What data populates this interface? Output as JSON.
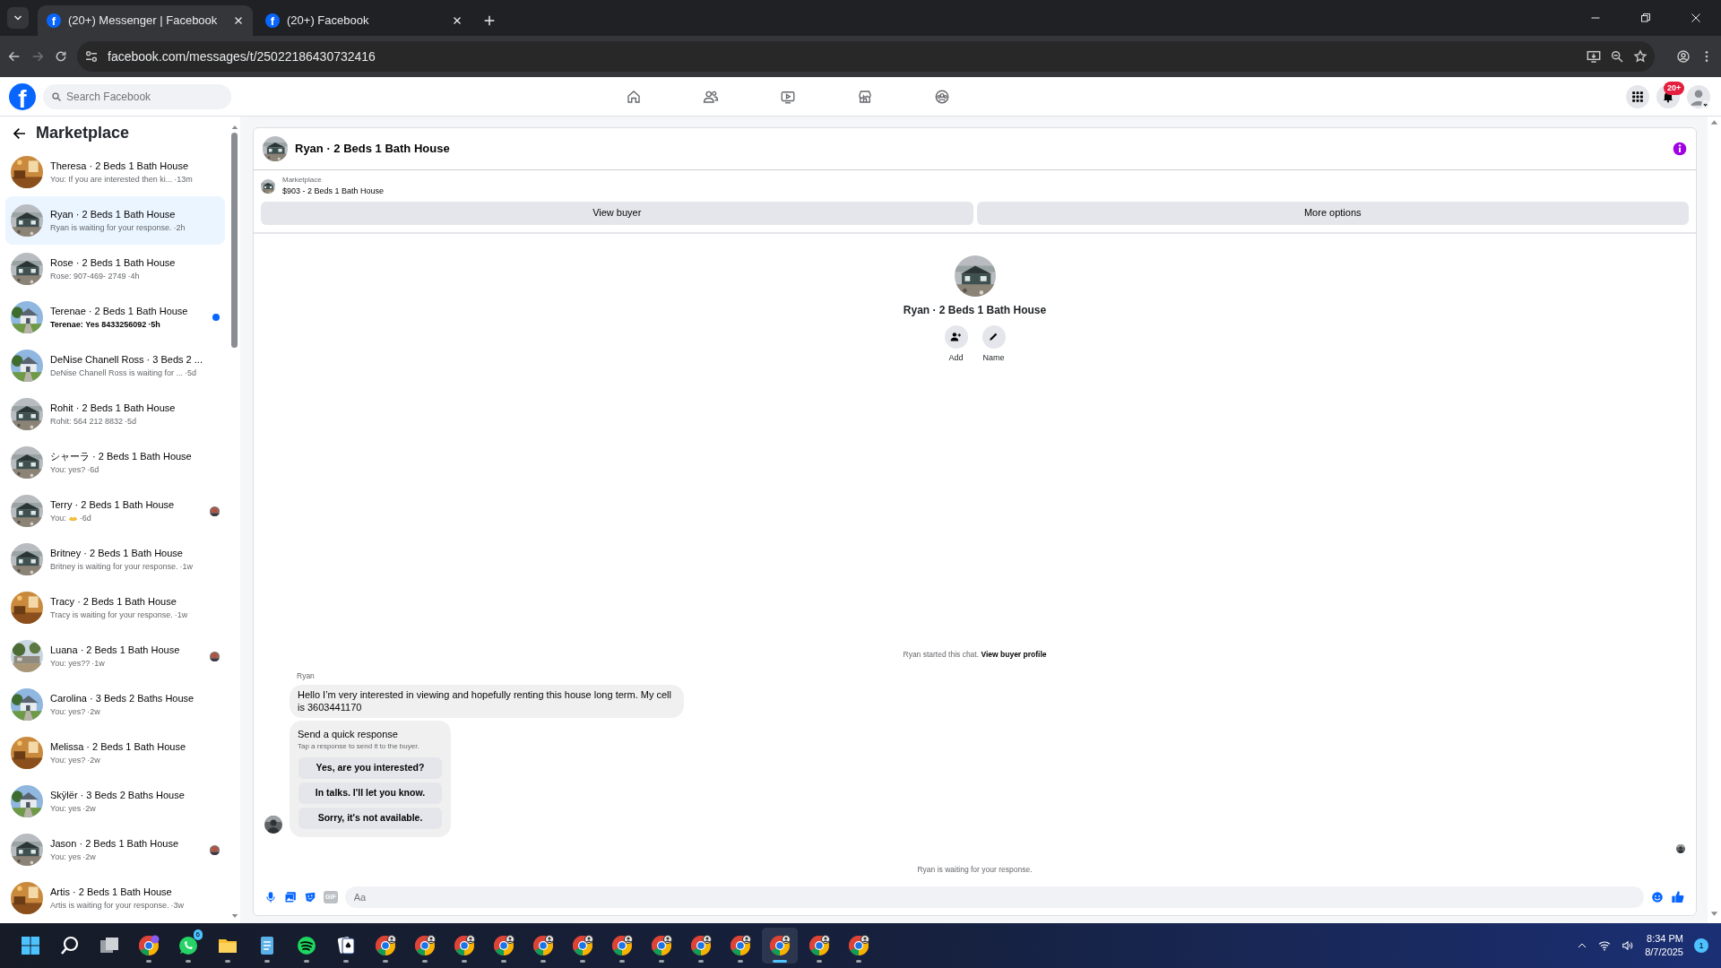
{
  "browser": {
    "tabs": [
      {
        "favicon": "f",
        "title": "(20+) Messenger | Facebook",
        "selected": true
      },
      {
        "favicon": "f",
        "title": "(20+) Facebook",
        "selected": false
      }
    ],
    "url": "facebook.com/messages/t/25022186430732416"
  },
  "topbar": {
    "logo": "f",
    "search": {
      "placeholder": "Search Facebook"
    },
    "nav": [
      {
        "kind": "home"
      },
      {
        "kind": "friends"
      },
      {
        "kind": "video"
      },
      {
        "kind": "marketplace"
      },
      {
        "kind": "groups"
      }
    ],
    "notification_badge": "20+"
  },
  "sidebar": {
    "title": "Marketplace",
    "conversations": [
      {
        "name": "Theresa · 2 Beds 1 Bath House",
        "preview": "You: If you are interested then ki...",
        "time": "·13m",
        "emoji": false,
        "selected": false,
        "unread": false,
        "seen": false
      },
      {
        "name": "Ryan · 2 Beds 1 Bath House",
        "preview": "Ryan is waiting for your response.",
        "time": "·2h",
        "emoji": false,
        "selected": true,
        "unread": false,
        "seen": false
      },
      {
        "name": "Rose · 2 Beds 1 Bath House",
        "preview": "Rose: 907-469- 2749",
        "time": "·4h",
        "emoji": false,
        "selected": false,
        "unread": false,
        "seen": false
      },
      {
        "name": "Terenae · 2 Beds 1 Bath House",
        "preview": "Terenae: Yes 8433256092",
        "time": "·5h",
        "emoji": false,
        "selected": false,
        "unread": true,
        "seen": false
      },
      {
        "name": "DeNise Chanell Ross · 3 Beds 2 ...",
        "preview": "DeNise Chanell Ross is waiting for ...",
        "time": "·5d",
        "emoji": false,
        "selected": false,
        "unread": false,
        "seen": false
      },
      {
        "name": "Rohit · 2 Beds 1 Bath House",
        "preview": "Rohit: 564 212 8832",
        "time": "·5d",
        "emoji": false,
        "selected": false,
        "unread": false,
        "seen": false
      },
      {
        "name": "シャーラ · 2 Beds 1 Bath House",
        "preview": "You: yes?",
        "time": "·6d",
        "emoji": false,
        "selected": false,
        "unread": false,
        "seen": false
      },
      {
        "name": "Terry · 2 Beds 1 Bath House",
        "preview": "You:",
        "time": "·6d",
        "emoji": true,
        "selected": false,
        "unread": false,
        "seen": true
      },
      {
        "name": "Britney · 2 Beds 1 Bath House",
        "preview": "Britney is waiting for your response.",
        "time": "·1w",
        "emoji": false,
        "selected": false,
        "unread": false,
        "seen": false
      },
      {
        "name": "Tracy · 2 Beds 1 Bath House",
        "preview": "Tracy is waiting for your response.",
        "time": "·1w",
        "emoji": false,
        "selected": false,
        "unread": false,
        "seen": false
      },
      {
        "name": "Luana · 2 Beds 1 Bath House",
        "preview": "You: yes??",
        "time": "·1w",
        "emoji": false,
        "selected": false,
        "unread": false,
        "seen": true
      },
      {
        "name": "Carolina · 3 Beds 2 Baths House",
        "preview": "You: yes?",
        "time": "·2w",
        "emoji": false,
        "selected": false,
        "unread": false,
        "seen": false
      },
      {
        "name": "Melissa · 2 Beds 1 Bath House",
        "preview": "You: yes?",
        "time": "·2w",
        "emoji": false,
        "selected": false,
        "unread": false,
        "seen": false
      },
      {
        "name": "Skÿlër · 3 Beds 2 Baths House",
        "preview": "You: yes",
        "time": "·2w",
        "emoji": false,
        "selected": false,
        "unread": false,
        "seen": false
      },
      {
        "name": "Jason · 2 Beds 1 Bath House",
        "preview": "You: yes",
        "time": "·2w",
        "emoji": false,
        "selected": false,
        "unread": false,
        "seen": true
      },
      {
        "name": "Artis · 2 Beds 1 Bath House",
        "preview": "Artis is waiting for your response.",
        "time": "·3w",
        "emoji": false,
        "selected": false,
        "unread": false,
        "seen": false
      }
    ]
  },
  "chat": {
    "title": "Ryan · 2 Beds 1 Bath House",
    "listing": {
      "source": "Marketplace",
      "title": "$903 - 2 Beds 1 Bath House"
    },
    "actions": [
      "View buyer",
      "More options"
    ],
    "profile": {
      "name": "Ryan · 2 Beds 1 Bath House",
      "buttons": [
        {
          "kind": "add",
          "label": "Add"
        },
        {
          "kind": "name",
          "label": "Name"
        }
      ]
    },
    "started": "Ryan started this chat.",
    "started_link": "View buyer profile",
    "messages": [
      {
        "sender": "Ryan",
        "text": "Hello I’m very interested in viewing and hopefully renting this house long term. My cell is 3603441170"
      }
    ],
    "quick_response": {
      "title": "Send a quick response",
      "subtitle": "Tap a response to send it to the buyer.",
      "options": [
        "Yes, are you interested?",
        "In talks. I'll let you know.",
        "Sorry, it's not available."
      ]
    },
    "status": "Ryan is waiting for your response.",
    "composer": {
      "placeholder": "Aa",
      "gif": "GIF"
    }
  },
  "taskbar": {
    "apps": [
      {
        "kind": "start",
        "selected": false
      },
      {
        "kind": "search",
        "selected": false
      },
      {
        "kind": "taskview",
        "selected": false
      },
      {
        "kind": "chrome",
        "selected": false
      },
      {
        "kind": "whatsapp",
        "badge": "6",
        "selected": false
      },
      {
        "kind": "folder",
        "selected": false
      },
      {
        "kind": "notepad",
        "selected": false
      },
      {
        "kind": "spotify",
        "selected": false
      },
      {
        "kind": "cards",
        "selected": false
      },
      {
        "kind": "chrome-profile",
        "selected": false
      },
      {
        "kind": "chrome-profile",
        "selected": false
      },
      {
        "kind": "chrome-profile",
        "selected": false
      },
      {
        "kind": "chrome-profile",
        "selected": false
      },
      {
        "kind": "chrome-profile",
        "selected": false
      },
      {
        "kind": "chrome-profile",
        "selected": false
      },
      {
        "kind": "chrome-profile",
        "selected": false
      },
      {
        "kind": "chrome-profile",
        "selected": false
      },
      {
        "kind": "chrome-profile",
        "selected": false
      },
      {
        "kind": "chrome-profile",
        "selected": false
      },
      {
        "kind": "chrome-profile",
        "selected": true
      },
      {
        "kind": "chrome-profile",
        "selected": false
      },
      {
        "kind": "chrome-profile",
        "selected": false
      }
    ],
    "time": "8:34 PM",
    "date": "8/7/2025",
    "notifications": "1"
  }
}
